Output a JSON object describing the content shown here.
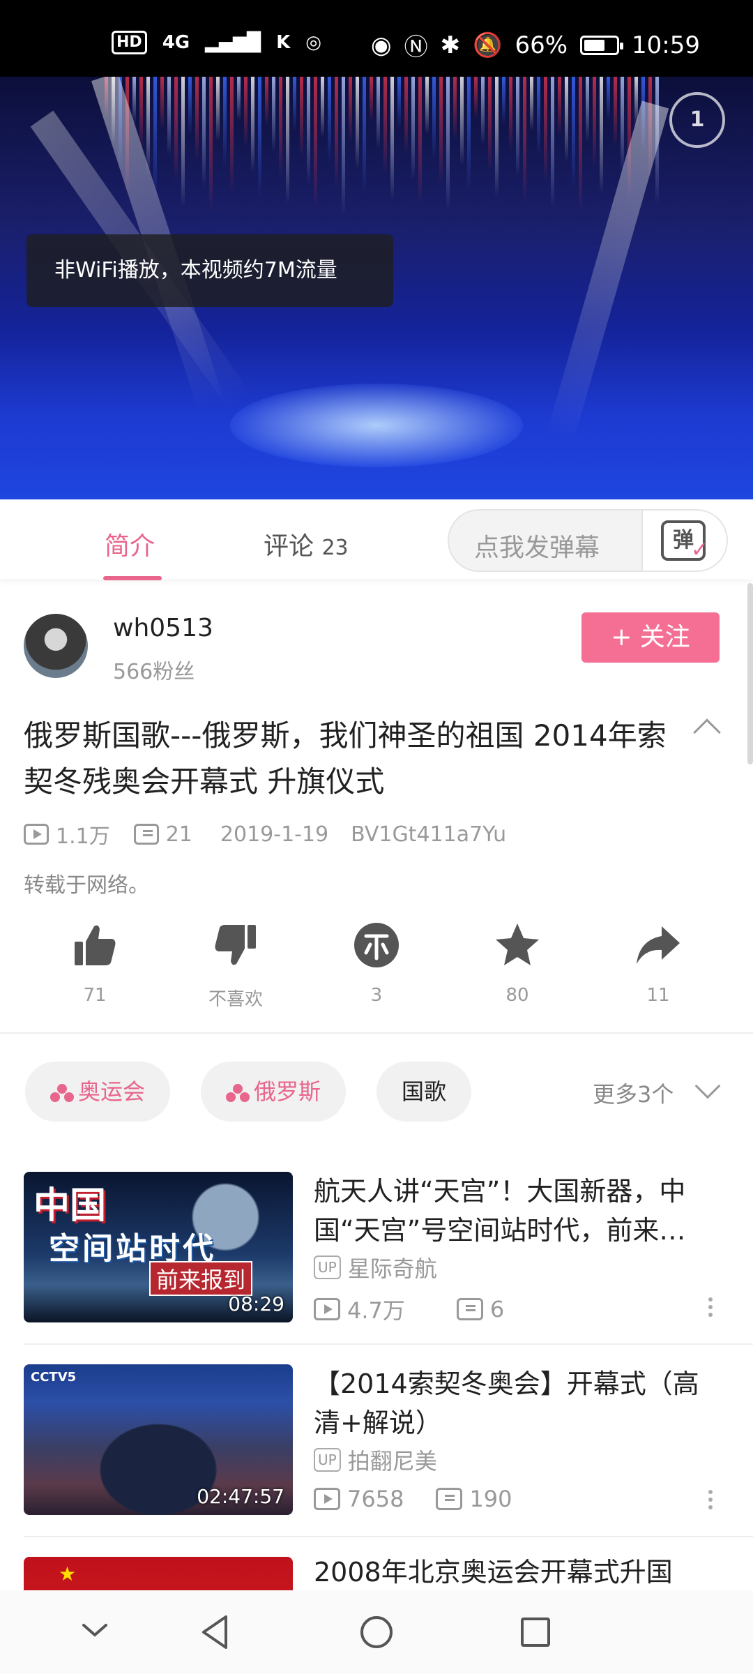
{
  "status_bar": {
    "hd": "HD",
    "network": "4G",
    "battery_percent": "66%",
    "battery_level": 0.66,
    "time": "10:59"
  },
  "video": {
    "toast": "非WiFi播放，本视频约7M流量"
  },
  "tabs": {
    "intro": "简介",
    "comments": "评论",
    "comments_count": "23",
    "danmaku_placeholder": "点我发弹幕",
    "danmaku_icon": "弹"
  },
  "uploader": {
    "name": "wh0513",
    "fans": "566粉丝",
    "follow_label": "+ 关注"
  },
  "video_info": {
    "title": "俄罗斯国歌---俄罗斯，我们神圣的祖国 2014年索契冬残奥会开幕式 升旗仪式",
    "views": "1.1万",
    "danmaku": "21",
    "date": "2019-1-19",
    "bvid": "BV1Gt411a7Yu",
    "desc": "转载于网络。"
  },
  "actions": {
    "like": "71",
    "dislike": "不喜欢",
    "coin": "3",
    "favorite": "80",
    "share": "11"
  },
  "tags": {
    "items": [
      "奥运会",
      "俄罗斯",
      "国歌"
    ],
    "more": "更多3个"
  },
  "recommendations": [
    {
      "title": "航天人讲“天宫”！大国新器，中国“天宫”号空间站时代，前来…",
      "up": "星际奇航",
      "views": "4.7万",
      "danmaku": "6",
      "duration": "08:29",
      "thumb_line1": "中国",
      "thumb_line2": "空间站时代",
      "thumb_line3": "前来报到"
    },
    {
      "title": "【2014索契冬奥会】开幕式（高清+解说）",
      "up": "拍翻尼美",
      "views": "7658",
      "danmaku": "190",
      "duration": "02:47:57"
    },
    {
      "title": "2008年北京奥运会开幕式升国"
    }
  ],
  "up_badge": "UP",
  "colors": {
    "accent": "#e8658c",
    "follow_bg": "#f56f95"
  }
}
